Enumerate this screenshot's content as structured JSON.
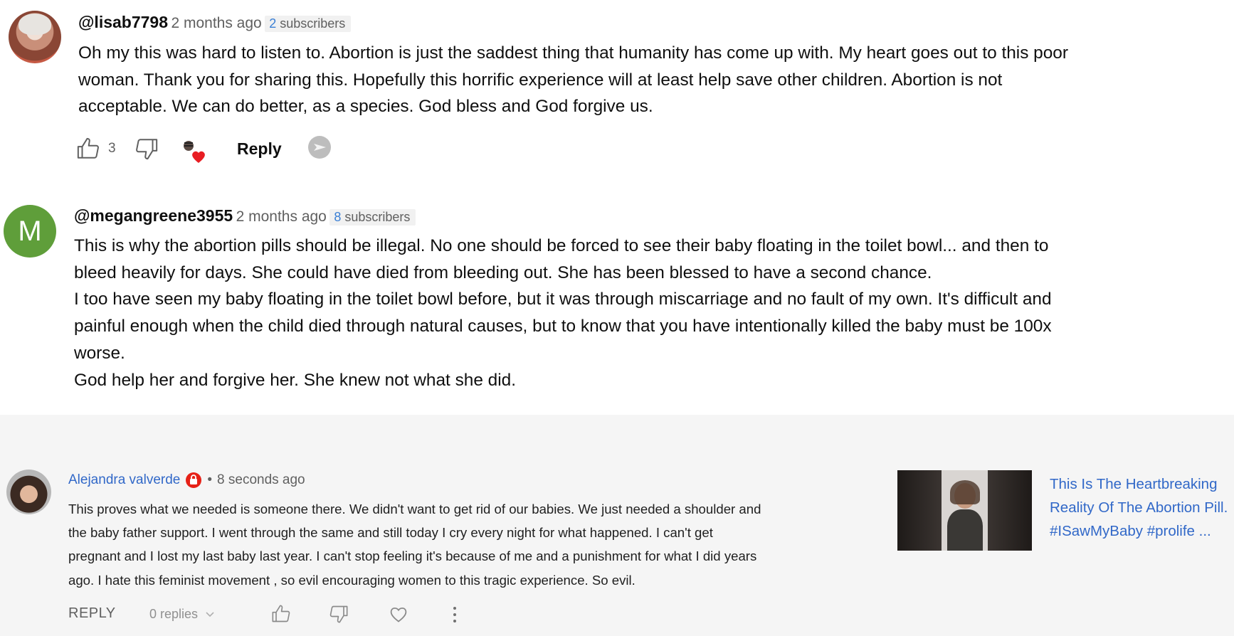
{
  "comments": [
    {
      "handle": "@lisab7798",
      "time": "2 months ago",
      "subscribers_count": "2",
      "subscribers_label": "subscribers",
      "lines": [
        "Oh my this was hard to listen to. Abortion is just the saddest thing that humanity has come up with. My heart goes out to this poor",
        "woman. Thank you for sharing this. Hopefully this horrific experience will at least help save other children. Abortion is not",
        "acceptable. We can do better, as a species. God bless and God forgive us."
      ],
      "likes": "3",
      "reply_label": "Reply"
    },
    {
      "handle": "@megangreene3955",
      "avatar_letter": "M",
      "time": "2 months ago",
      "subscribers_count": "8",
      "subscribers_label": "subscribers",
      "lines": [
        "This is why the abortion pills should be illegal. No one should be forced to see their baby floating in the toilet bowl... and then to",
        "bleed heavily for days. She could have died from bleeding out. She has been blessed to have a second chance.",
        "I too have seen my baby floating in the toilet bowl before, but it was through miscarriage and no fault of my own. It's difficult and",
        "painful enough when the child died through natural causes, but to know that you have intentionally killed the baby must be 100x",
        "worse.",
        "God help her and forgive her. She knew not what she did."
      ]
    }
  ],
  "studio_comment": {
    "author": "Alejandra valverde",
    "separator": "•",
    "time": "8 seconds ago",
    "lines": [
      "This proves what we needed is someone there. We didn't want to get rid of our babies. We just needed a shoulder and",
      "the baby father support. I went through the same and still today I cry every night for what happened. I can't get",
      "pregnant and I lost my last baby last year. I can't stop feeling it's because of me and a punishment for what I did years",
      "ago. I hate this feminist movement , so evil encouraging women to this tragic experience. So evil."
    ],
    "reply_label": "REPLY",
    "replies_label": "0 replies",
    "video": {
      "title_lines": [
        "This Is The Heartbreaking",
        "Reality Of The Abortion Pill.",
        "#ISawMyBaby #prolife ..."
      ]
    }
  },
  "colors": {
    "link_blue": "#3168c8",
    "heart_red": "#e81d23",
    "avatar_green": "#5f9e3a"
  },
  "icons": [
    "thumb-up-icon",
    "thumb-down-icon",
    "loved-by-creator-heart-icon",
    "translate-icon",
    "badge-icon",
    "chevron-down-icon",
    "heart-icon",
    "more-vert-icon"
  ]
}
